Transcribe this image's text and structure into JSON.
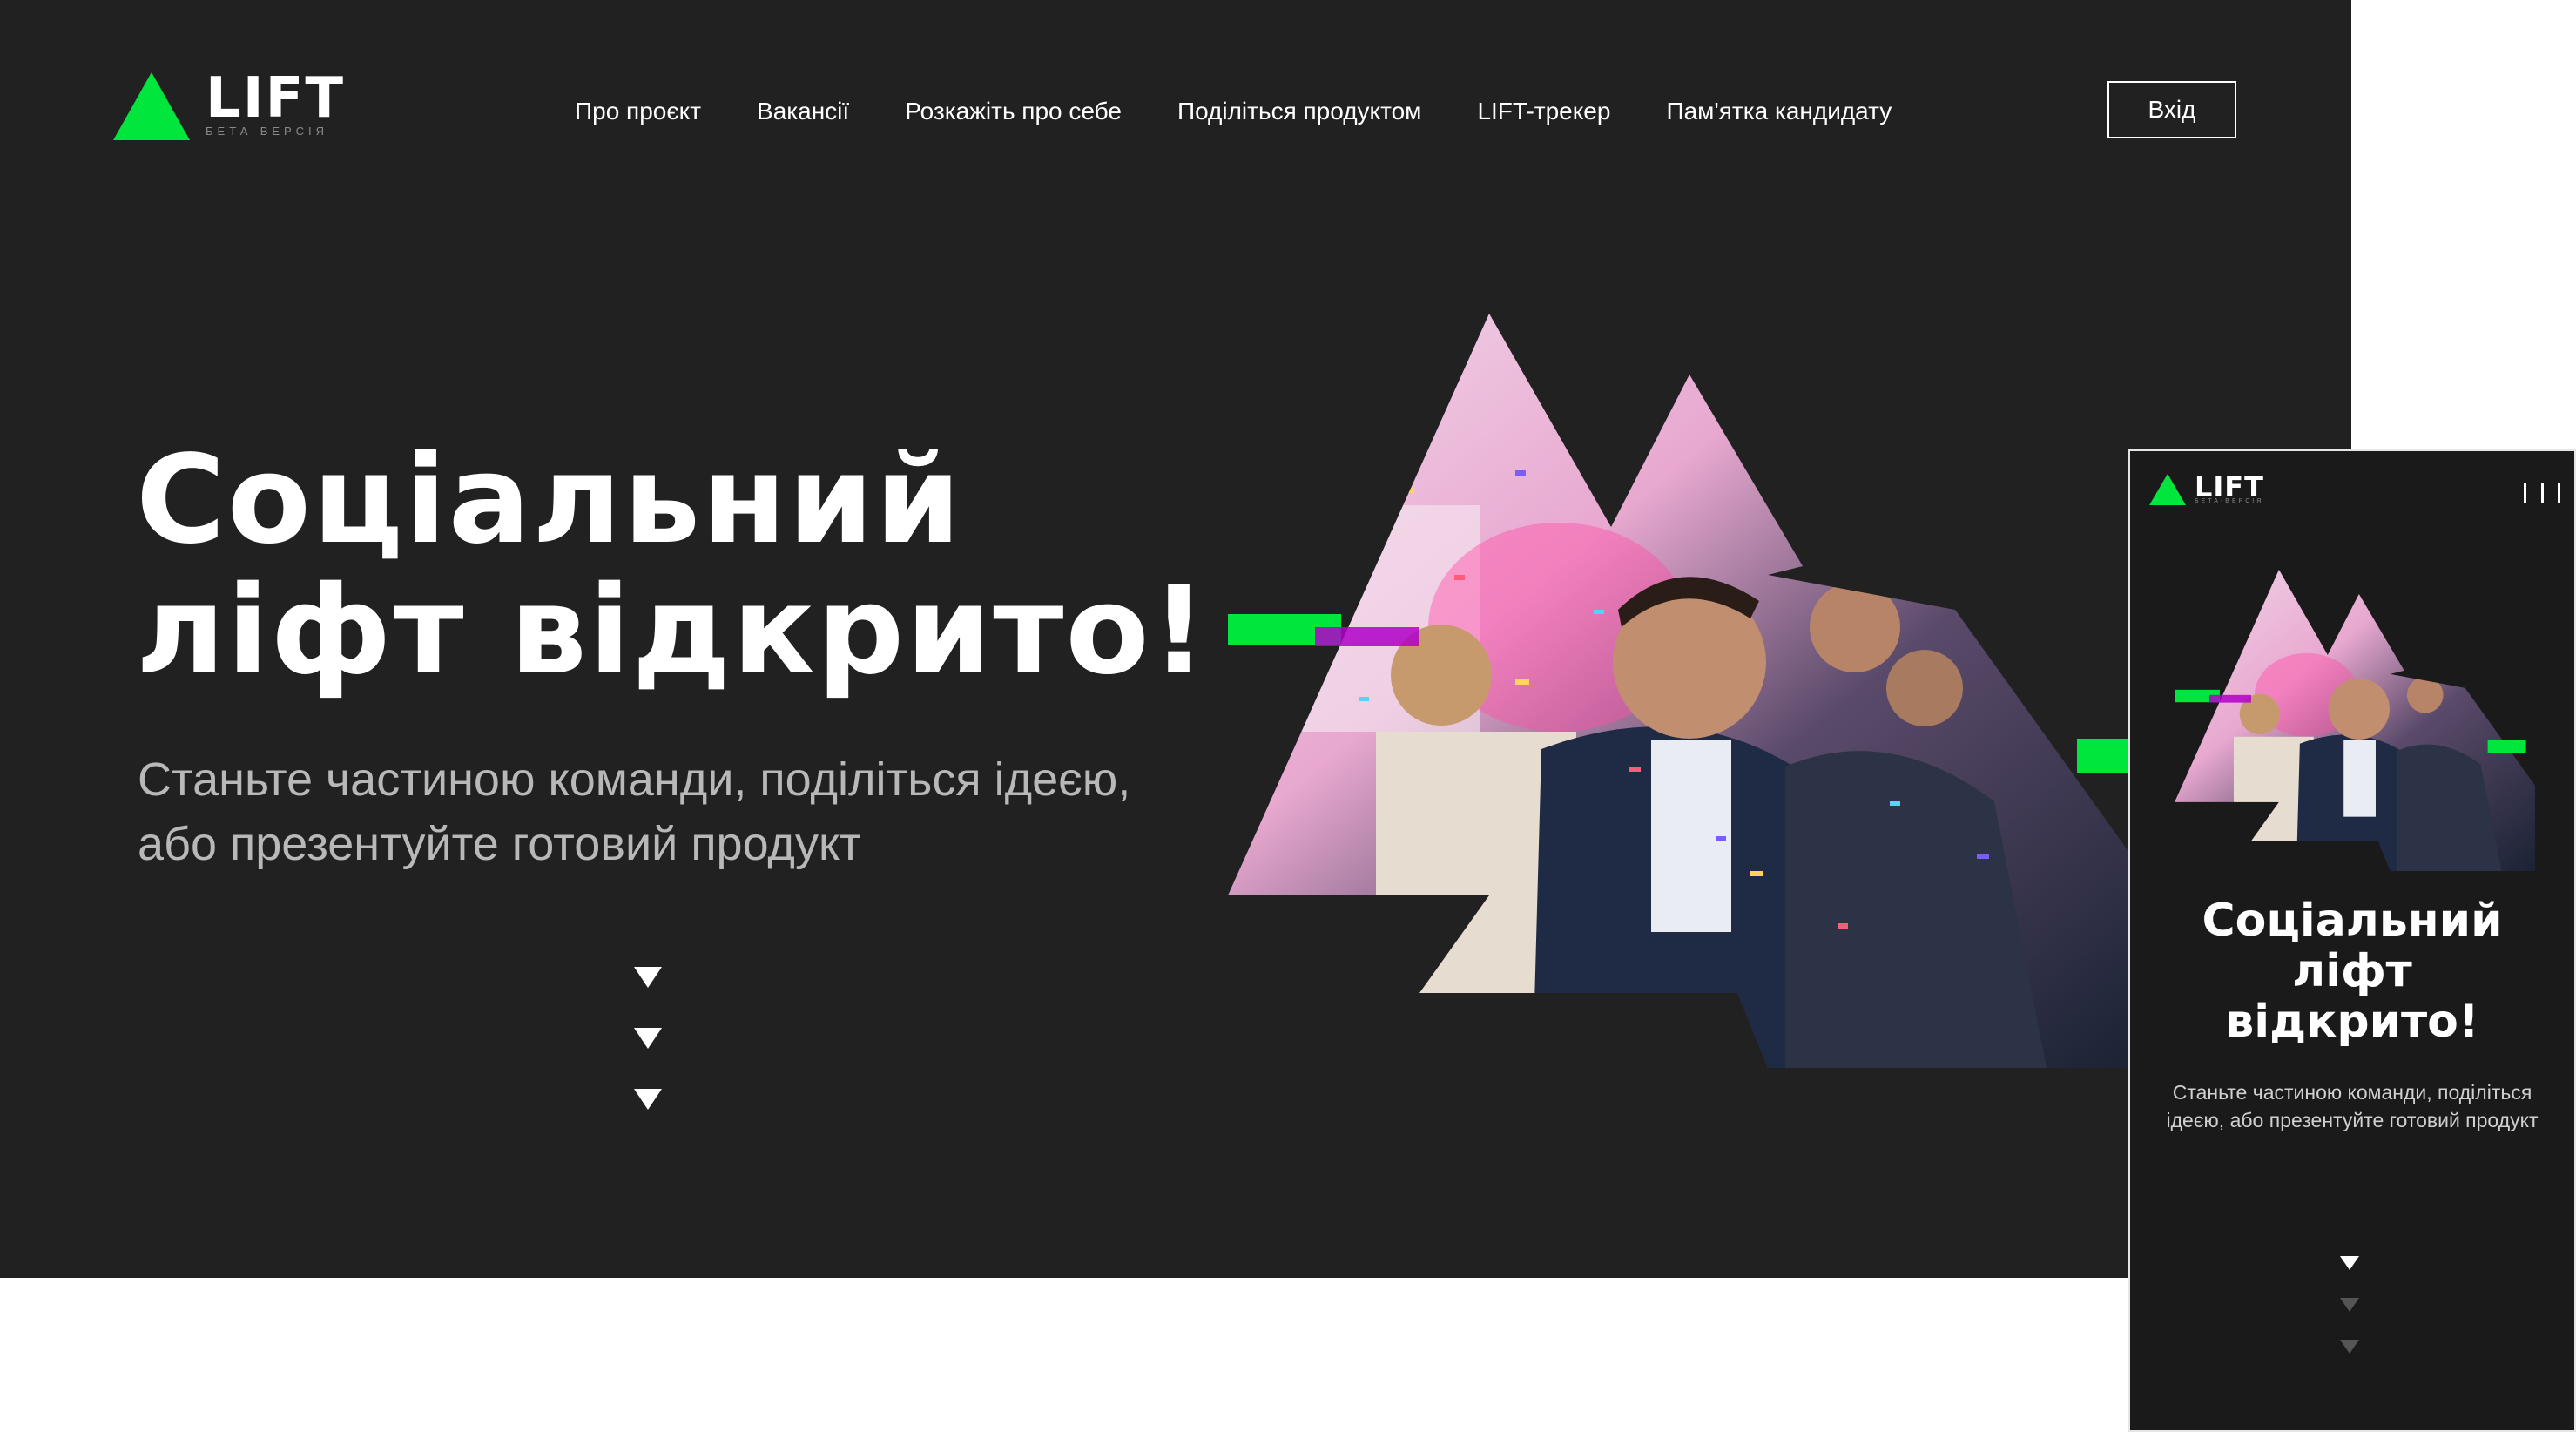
{
  "brand": {
    "name": "LIFT",
    "tagline": "БЕТА-ВЕРСІЯ",
    "accent_color": "#00e63d",
    "background_color": "#212121"
  },
  "nav": {
    "items": [
      {
        "label": "Про проєкт"
      },
      {
        "label": "Вакансії"
      },
      {
        "label": "Розкажіть про себе"
      },
      {
        "label": "Поділіться продуктом"
      },
      {
        "label": "LIFT-трекер"
      },
      {
        "label": "Пам'ятка кандидату"
      }
    ],
    "login_label": "Вхід"
  },
  "hero": {
    "title_line1": "Соціальний",
    "title_line2": "ліфт відкрито!",
    "subtitle_line1": "Станьте частиною команди, поділіться ідеєю,",
    "subtitle_line2": "або презентуйте готовий продукт",
    "scroll_icon": "triangle-down-icon",
    "image_description_icon": "mountain-photo-collage"
  },
  "mobile": {
    "menu_icon": "hamburger-vertical-icon",
    "title_line1": "Соціальний",
    "title_line2": "ліфт",
    "title_line3": "відкрито!",
    "subtitle": "Станьте частиною команди, поділіться ідеєю, або презентуйте готовий продукт"
  }
}
